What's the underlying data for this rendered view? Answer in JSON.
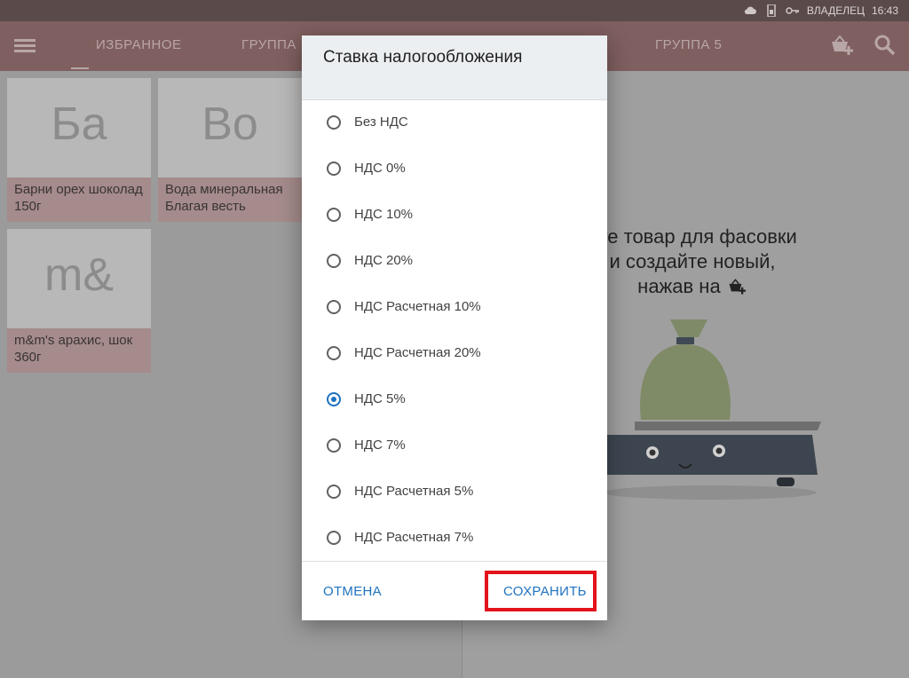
{
  "status_bar": {
    "owner": "ВЛАДЕЛЕЦ",
    "time": "16:43"
  },
  "app_bar": {
    "tabs": [
      {
        "label": "ИЗБРАННОЕ",
        "active": true
      },
      {
        "label": "ГРУППА"
      },
      {
        "label": "ГРУППА 5"
      }
    ]
  },
  "products": [
    {
      "initials": "Ба",
      "name": "Барни орех шоколад 150г"
    },
    {
      "initials": "Во",
      "name": "Вода минеральная Благая весть"
    },
    {
      "initials": "m&",
      "name": "m&m's арахис, шок 360г"
    }
  ],
  "hint": {
    "line1": "ите товар для фасовки",
    "line2": "и создайте новый,",
    "line3": "нажав на"
  },
  "dialog": {
    "title": "Ставка налогообложения",
    "options": [
      {
        "label": "Без НДС",
        "selected": false
      },
      {
        "label": "НДС 0%",
        "selected": false
      },
      {
        "label": "НДС 10%",
        "selected": false
      },
      {
        "label": "НДС 20%",
        "selected": false
      },
      {
        "label": "НДС Расчетная 10%",
        "selected": false
      },
      {
        "label": "НДС Расчетная 20%",
        "selected": false
      },
      {
        "label": "НДС 5%",
        "selected": true
      },
      {
        "label": "НДС 7%",
        "selected": false
      },
      {
        "label": "НДС Расчетная 5%",
        "selected": false
      },
      {
        "label": "НДС Расчетная 7%",
        "selected": false
      }
    ],
    "cancel_label": "ОТМЕНА",
    "save_label": "СОХРАНИТЬ"
  },
  "colors": {
    "accent": "#1e72c0",
    "highlight": "#e3131b",
    "app_bar": "#7f5f5f"
  },
  "icons": [
    "cloud-icon",
    "sim-icon",
    "key-icon",
    "menu-icon",
    "add-basket-icon",
    "search-icon",
    "scale-illustration"
  ]
}
